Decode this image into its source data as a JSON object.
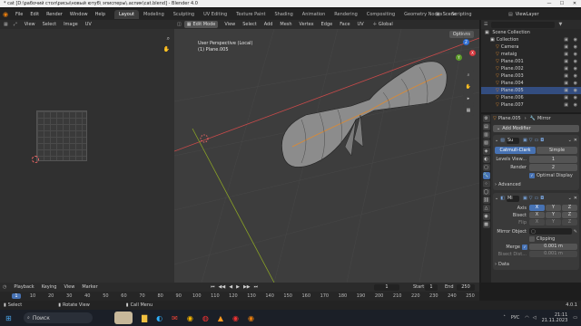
{
  "window": {
    "title": "* cat [D:\\рабочий стол\\рисы\\новый ютуб\\ эписперы\\.аспик\\cat.blend] - Blender 4.0",
    "min": "—",
    "max": "☐",
    "close": "✕"
  },
  "menu": {
    "items": [
      "File",
      "Edit",
      "Render",
      "Window",
      "Help"
    ]
  },
  "workspaces": [
    "Layout",
    "Modeling",
    "Sculpting",
    "UV Editing",
    "Texture Paint",
    "Shading",
    "Animation",
    "Rendering",
    "Compositing",
    "Geometry Nodes",
    "Scripting"
  ],
  "scene": {
    "label": "Scene",
    "view_layer": "ViewLayer"
  },
  "uv_editor": {
    "menus": [
      "View",
      "Select",
      "Image"
    ],
    "uv_label": "UV"
  },
  "viewport": {
    "mode": "Edit Mode",
    "menus": [
      "View",
      "Select",
      "Add",
      "Mesh",
      "Vertex",
      "Edge",
      "Face",
      "UV"
    ],
    "orientation": "Global",
    "options": "Options",
    "info_line1": "User Perspective (Local)",
    "info_line2": "(1) Plane.005",
    "axis": {
      "x": "X",
      "y": "Y",
      "z": "Z"
    }
  },
  "outliner": {
    "title": "Scene Collection",
    "items": [
      {
        "label": "Collection",
        "indent": 1,
        "selected": false
      },
      {
        "label": "Camera",
        "indent": 2,
        "selected": false
      },
      {
        "label": "metaig",
        "indent": 2,
        "selected": false
      },
      {
        "label": "Plane.001",
        "indent": 2,
        "selected": false
      },
      {
        "label": "Plane.002",
        "indent": 2,
        "selected": false
      },
      {
        "label": "Plane.003",
        "indent": 2,
        "selected": false
      },
      {
        "label": "Plane.004",
        "indent": 2,
        "selected": false
      },
      {
        "label": "Plane.005",
        "indent": 2,
        "selected": true
      },
      {
        "label": "Plane.006",
        "indent": 2,
        "selected": false
      },
      {
        "label": "Plane.007",
        "indent": 2,
        "selected": false
      }
    ]
  },
  "properties": {
    "object": "Plane.005",
    "modifier_type": "Mirror",
    "add_modifier": "Add Modifier",
    "subsurf": {
      "name": "Su",
      "mode_a": "Catmull-Clark",
      "mode_b": "Simple",
      "levels_label": "Levels View...",
      "levels_value": "1",
      "render_label": "Render",
      "render_value": "2",
      "optimal": "Optimal Display",
      "advanced": "Advanced"
    },
    "mirror": {
      "name": "Mi",
      "axis_label": "Axis",
      "bisect_label": "Bisect",
      "flip_label": "Flip",
      "x": "X",
      "y": "Y",
      "z": "Z",
      "mirror_object": "Mirror Object",
      "clipping": "Clipping",
      "merge_label": "Merge",
      "merge_value": "0.001 m",
      "bisect_dist_label": "Bisect Dist...",
      "bisect_dist_value": "0.001 m",
      "data": "Data"
    }
  },
  "timeline": {
    "menus": [
      "Playback",
      "Keying",
      "View",
      "Marker"
    ],
    "current_frame": "1",
    "start_label": "Start",
    "start_value": "1",
    "end_label": "End",
    "end_value": "250",
    "ticks": [
      "1",
      "10",
      "20",
      "30",
      "40",
      "50",
      "60",
      "70",
      "80",
      "90",
      "100",
      "110",
      "120",
      "130",
      "140",
      "150",
      "160",
      "170",
      "180",
      "190",
      "200",
      "210",
      "220",
      "230",
      "240",
      "250"
    ]
  },
  "status": {
    "left": "Select",
    "middle": "Rotate View",
    "right": "Call Menu",
    "version": "4.0.1"
  },
  "taskbar": {
    "search": "Поиск",
    "lang": "РУС",
    "time": "21:11",
    "date": "21.11.2023"
  }
}
